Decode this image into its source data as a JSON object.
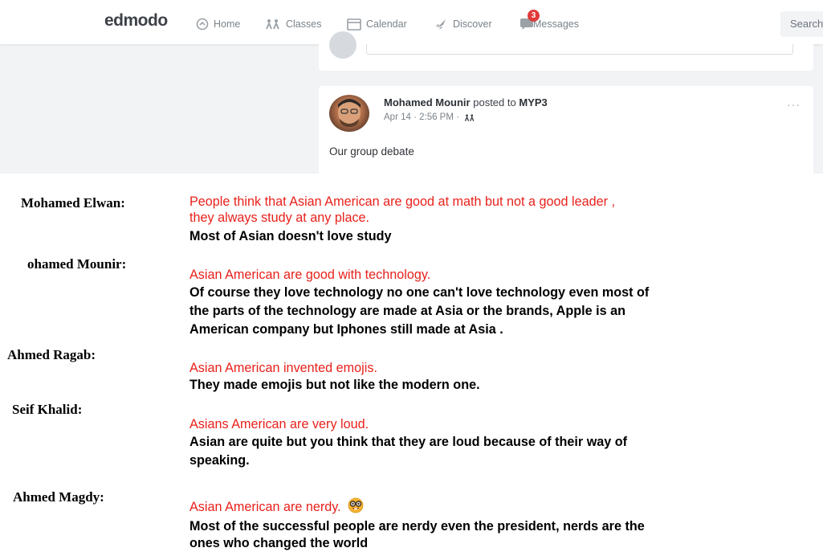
{
  "nav": {
    "logo": "edmodo",
    "items": [
      {
        "label": "Home",
        "icon": "home-icon"
      },
      {
        "label": "Classes",
        "icon": "classes-icon"
      },
      {
        "label": "Calendar",
        "icon": "calendar-icon"
      },
      {
        "label": "Discover",
        "icon": "rocket-icon"
      },
      {
        "label": "Messages",
        "icon": "chat-icon"
      }
    ],
    "messages_badge": "3",
    "search_placeholder": "Search"
  },
  "post": {
    "author": "Mohamed Mounir",
    "posted_to_text": "posted to",
    "group": "MYP3",
    "timestamp": "Apr 14 · 2:56 PM ·",
    "more": "···",
    "text": "Our group debate"
  },
  "debate": [
    {
      "name": "Mohamed Elwan:",
      "claim": [
        "People think that Asian American are good at math but not a good leader ,",
        "they always study at any place."
      ],
      "response": [
        "Most of Asian doesn't love study"
      ]
    },
    {
      "name": "ohamed Mounir:",
      "claim": [
        "Asian American are good with technology."
      ],
      "response": [
        "Of course they love technology no one can't love technology even most of",
        "the parts of the technology are made at Asia or the brands, Apple is an",
        "American company but Iphones still made at Asia ."
      ]
    },
    {
      "name": "Ahmed Ragab:",
      "claim": [
        "Asian American invented emojis."
      ],
      "response": [
        "They made emojis but not like the modern one."
      ]
    },
    {
      "name": "Seif Khalid:",
      "claim": [
        "Asians American are very loud."
      ],
      "response": [
        "Asian are quite but you think that they are loud because of their way of",
        "speaking."
      ]
    },
    {
      "name": "Ahmed Magdy:",
      "claim": [
        "Asian American are nerdy."
      ],
      "response": [
        "Most of the successful people are nerdy even the president, nerds are the",
        "ones who changed the world"
      ]
    }
  ],
  "colors": {
    "claim": "#e8211b",
    "response": "#000000",
    "badge": "#e03a3a"
  }
}
